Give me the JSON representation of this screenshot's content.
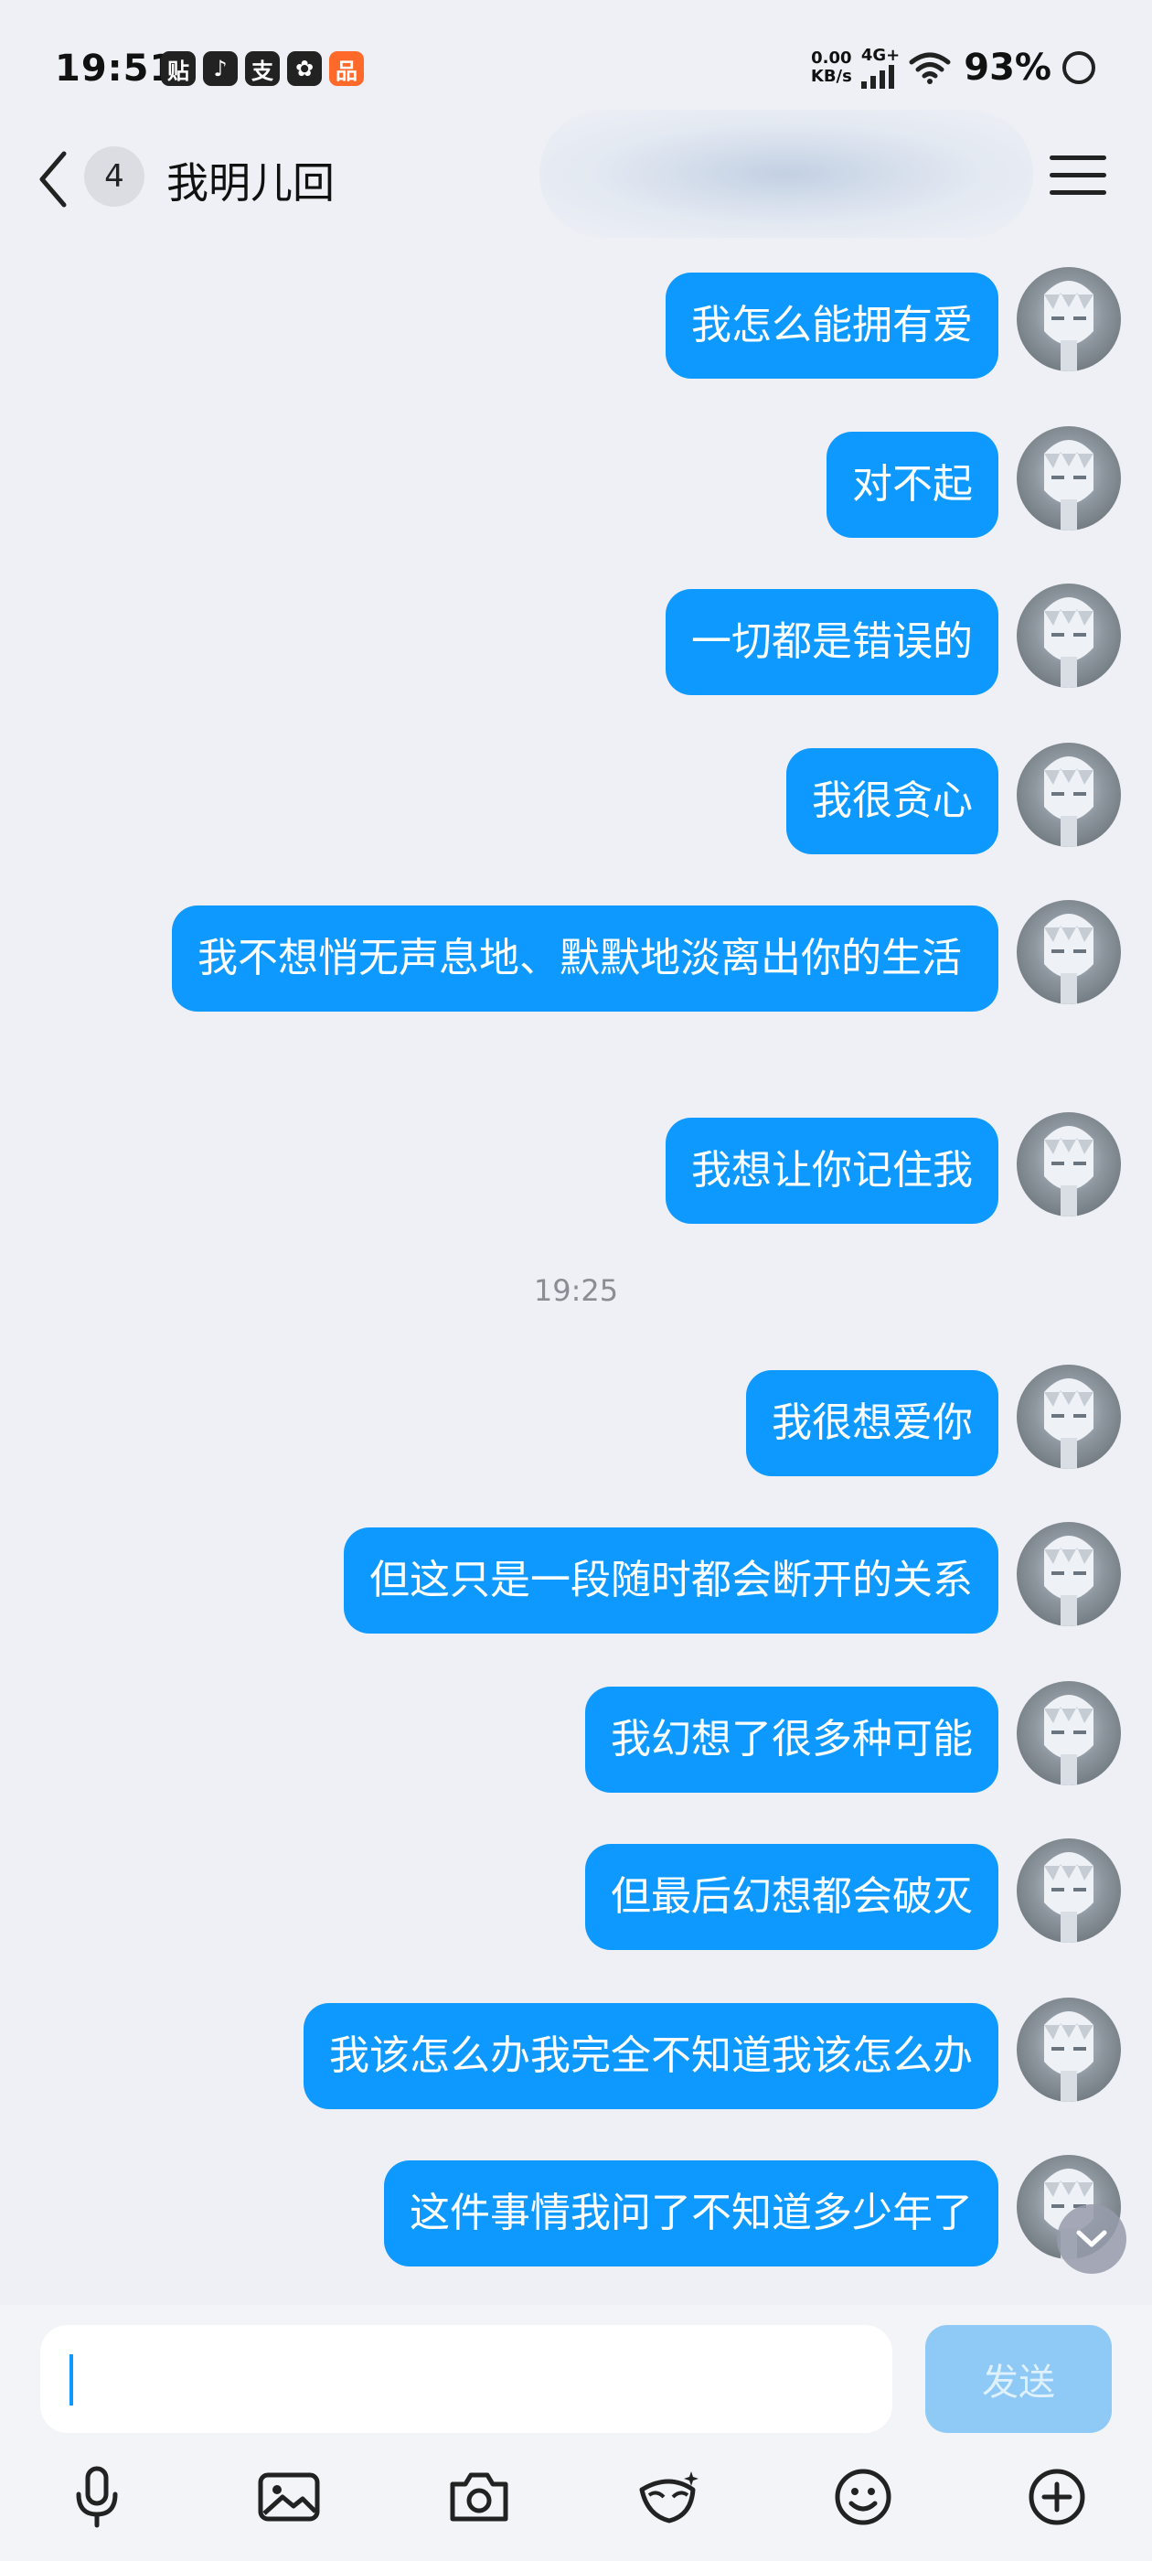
{
  "status_bar": {
    "time": "19:51",
    "app_icons": [
      "贴",
      "♪",
      "支",
      "✿",
      "品"
    ],
    "net_speed_top": "0.00",
    "net_speed_bottom": "KB/s",
    "net_type": "4G+",
    "battery": "93%"
  },
  "header": {
    "unread_count": "4",
    "title": "我明儿回"
  },
  "messages": [
    {
      "text": "我怎么能拥有爱"
    },
    {
      "text": "对不起"
    },
    {
      "text": "一切都是错误的"
    },
    {
      "text": "我很贪心"
    },
    {
      "text": "我不想悄无声息地、默默地淡离出你的生活"
    },
    {
      "text": "我想让你记住我"
    },
    {
      "text": "我很想爱你"
    },
    {
      "text": "但这只是一段随时都会断开的关系"
    },
    {
      "text": "我幻想了很多种可能"
    },
    {
      "text": "但最后幻想都会破灭"
    },
    {
      "text": "我该怎么办我完全不知道我该怎么办"
    },
    {
      "text": "这件事情我问了不知道多少年了"
    }
  ],
  "timestamp": "19:25",
  "input": {
    "value": "",
    "send_label": "发送"
  },
  "toolbar": {
    "icons": [
      "microphone-icon",
      "image-icon",
      "camera-icon",
      "mask-icon",
      "emoji-icon",
      "plus-icon"
    ]
  },
  "colors": {
    "bubble": "#0d99ff",
    "background": "#eef0f5",
    "send_disabled": "#8fcaf6"
  }
}
